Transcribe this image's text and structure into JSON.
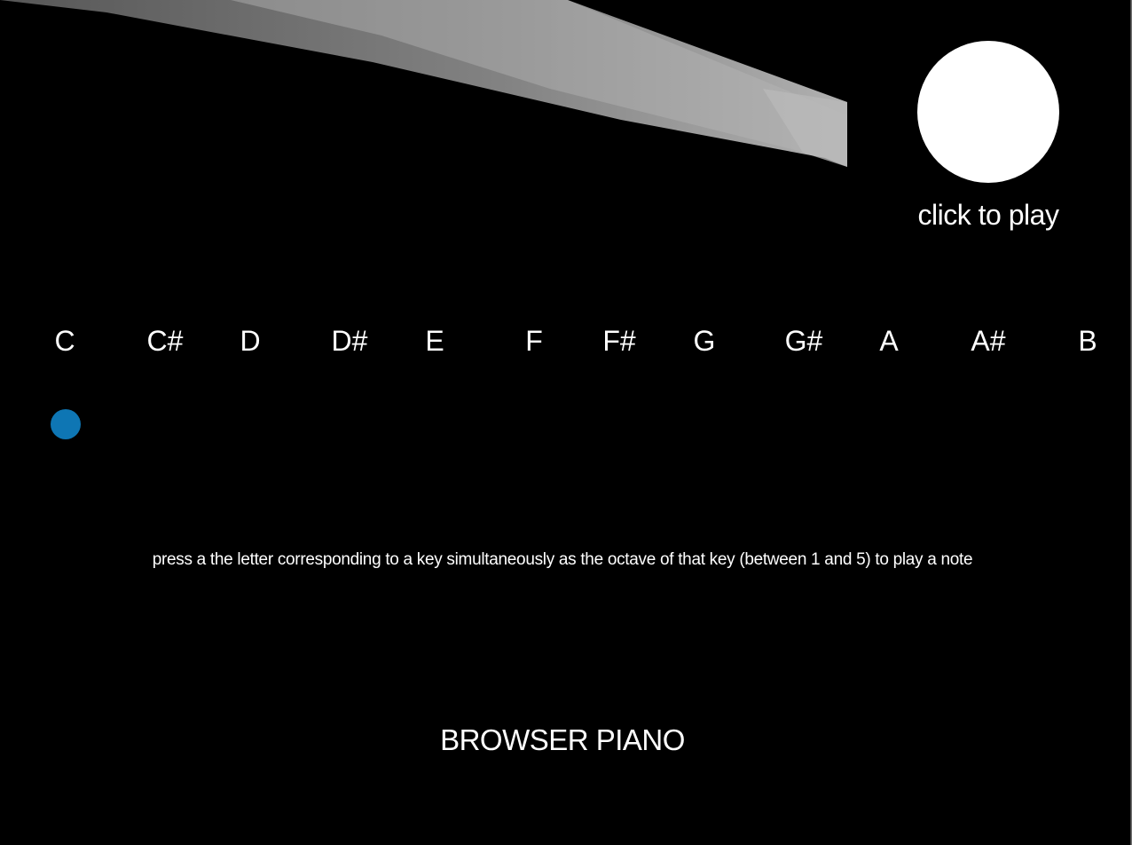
{
  "player": {
    "play_label": "click to play"
  },
  "keys": {
    "notes": [
      "C",
      "C#",
      "D",
      "D#",
      "E",
      "F",
      "F#",
      "G",
      "G#",
      "A",
      "A#",
      "B"
    ]
  },
  "instructions": "press a the letter corresponding to a key simultaneously as the octave of that key (between 1 and 5) to play a note",
  "title": "BROWSER PIANO",
  "colors": {
    "background": "#000000",
    "text": "#ffffff",
    "indicator": "#0e76b4",
    "play_button": "#ffffff"
  }
}
